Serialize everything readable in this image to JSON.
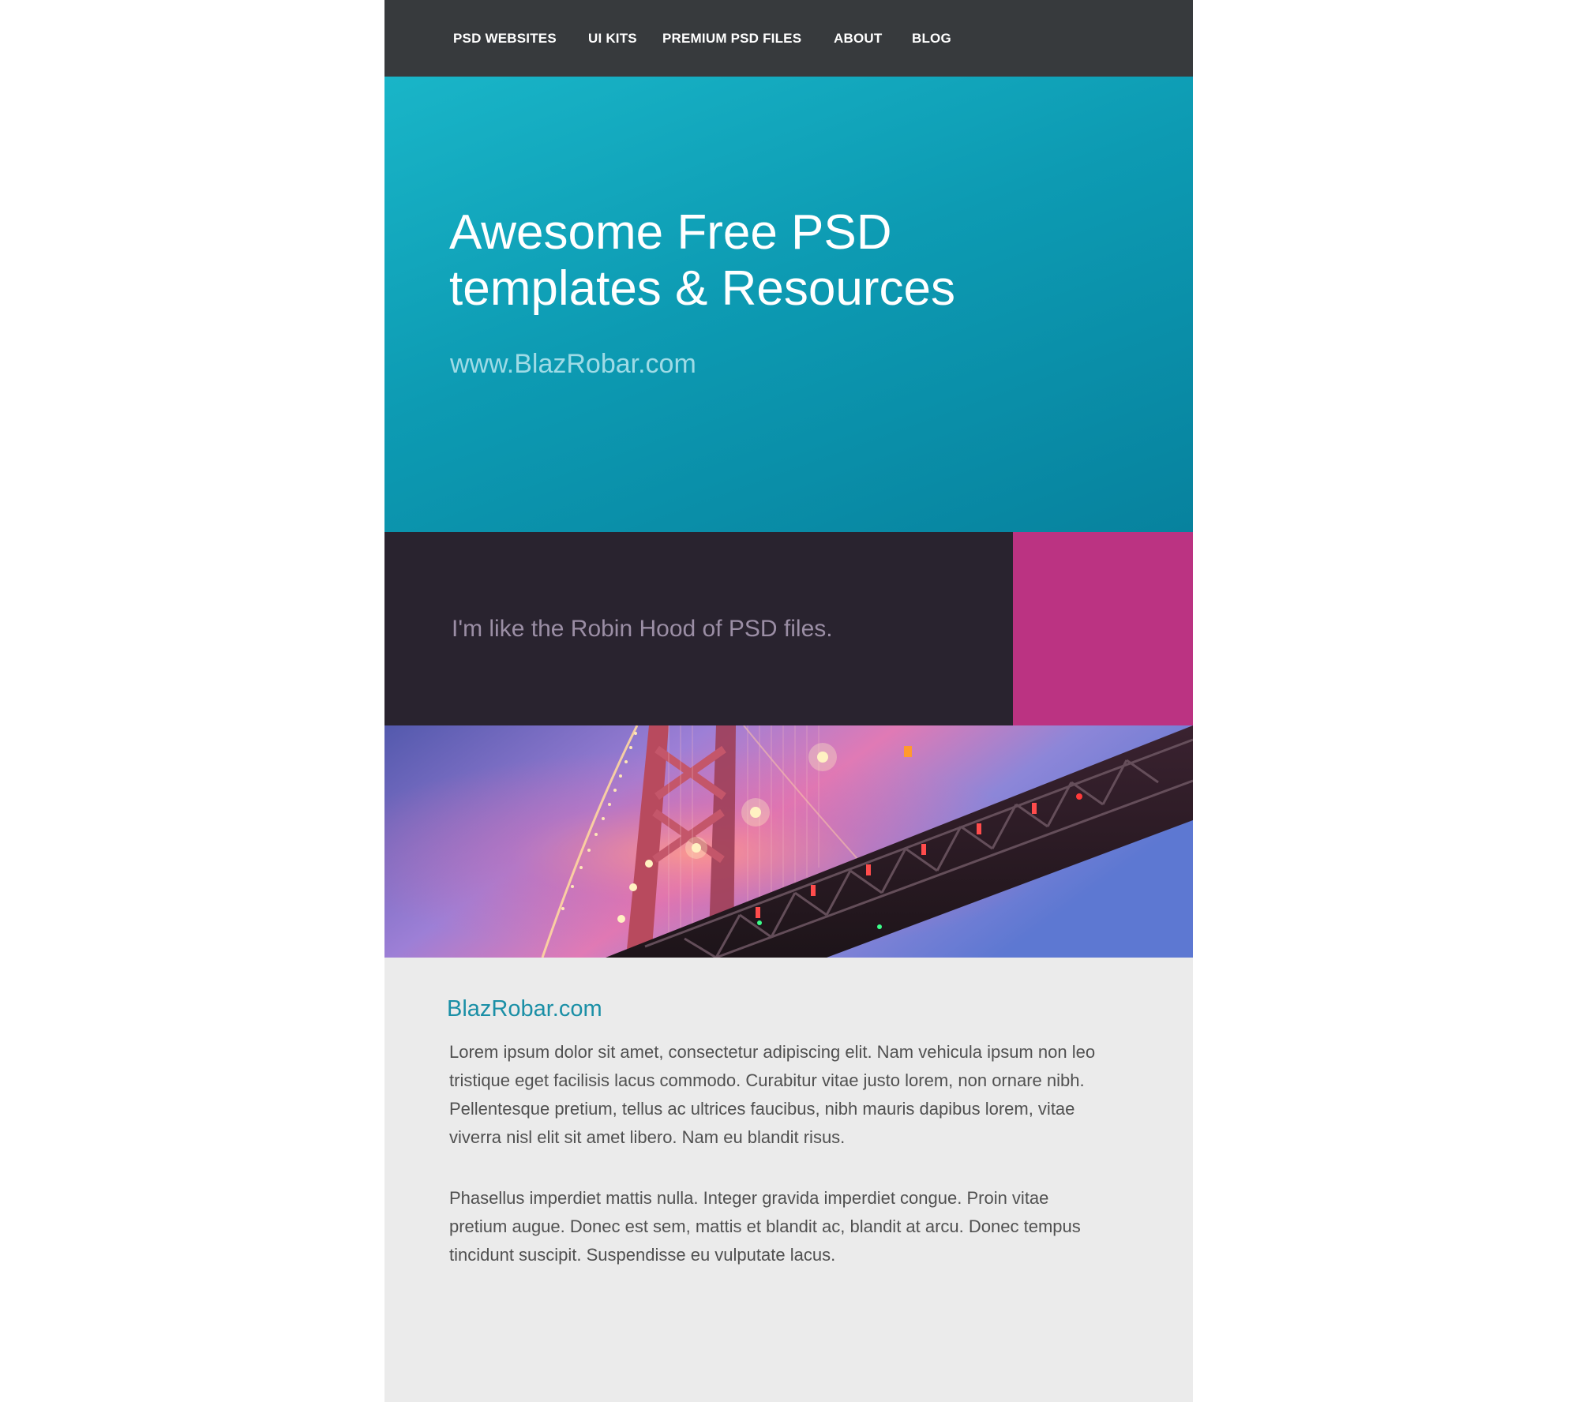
{
  "nav": {
    "items": [
      {
        "label": "PSD WEBSITES"
      },
      {
        "label": "UI KITS"
      },
      {
        "label": "PREMIUM PSD FILES"
      },
      {
        "label": "ABOUT"
      },
      {
        "label": "BLOG"
      }
    ]
  },
  "hero": {
    "title": "Awesome Free PSD templates & Resources",
    "url": "www.BlazRobar.com"
  },
  "band": {
    "tagline": "I'm like the Robin Hood of PSD files."
  },
  "content": {
    "title": "BlazRobar.com",
    "paragraphs": [
      "Lorem ipsum dolor sit amet, consectetur adipiscing elit. Nam vehicula ipsum non leo tristique eget facilisis lacus commodo. Curabitur vitae justo lorem, non ornare nibh. Pellentesque pretium, tellus ac ultrices faucibus, nibh mauris dapibus lorem, vitae viverra nisl elit sit amet libero. Nam eu blandit risus.",
      "Phasellus imperdiet mattis nulla. Integer gravida imperdiet congue. Proin vitae pretium augue. Donec est sem, mattis et blandit ac, blandit at arcu. Donec tempus tincidunt suscipit. Suspendisse eu vulputate lacus."
    ]
  },
  "colors": {
    "nav_bg": "#373a3d",
    "hero_accent": "#0d9bb3",
    "band_bg": "#29232f",
    "band_accent": "#bb3382",
    "link_title": "#1a8fa6"
  },
  "images": {
    "photo": "bridge-at-dusk-photo"
  }
}
